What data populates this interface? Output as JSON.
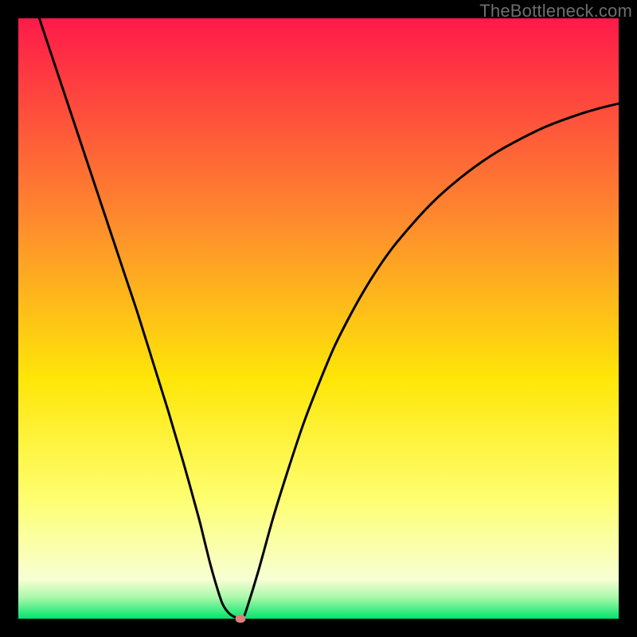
{
  "watermark": "TheBottleneck.com",
  "colors": {
    "top": "#fe1a49",
    "mid_upper": "#fe8f2c",
    "mid": "#fee608",
    "mid_lower": "#feff70",
    "lower_pale": "#f7ffd4",
    "bottom": "#00e46e",
    "curve": "#000000",
    "marker": "#e77b79",
    "frame": "#000000"
  },
  "chart_data": {
    "type": "line",
    "title": "",
    "xlabel": "",
    "ylabel": "",
    "xlim": [
      0,
      100
    ],
    "ylim": [
      0,
      100
    ],
    "x": [
      3.5,
      5,
      7.5,
      10,
      12.5,
      15,
      17.5,
      20,
      22.5,
      25,
      27.5,
      30,
      31,
      32,
      33,
      34,
      35,
      36,
      37,
      37.5,
      38,
      40,
      42.5,
      45,
      47.5,
      50,
      52.5,
      55,
      57.5,
      60,
      62.5,
      65,
      67.5,
      70,
      72.5,
      75,
      77.5,
      80,
      82.5,
      85,
      87.5,
      90,
      92.5,
      95,
      97.5,
      100
    ],
    "values": [
      100,
      95.5,
      88,
      80.5,
      73,
      65.5,
      58,
      50.5,
      42.5,
      34.5,
      26,
      17,
      13,
      9,
      5.5,
      2.5,
      1,
      0.3,
      0,
      0.3,
      1.5,
      8,
      17,
      25,
      32.5,
      39,
      45,
      50,
      54.5,
      58.5,
      62,
      65,
      67.8,
      70.3,
      72.5,
      74.5,
      76.3,
      77.9,
      79.3,
      80.6,
      81.8,
      82.8,
      83.7,
      84.5,
      85.2,
      85.8
    ],
    "marker": {
      "x": 37,
      "y": 0
    },
    "gradient_stops": [
      {
        "offset": 0.0,
        "color": "#fe1a49"
      },
      {
        "offset": 0.35,
        "color": "#fe8f2c"
      },
      {
        "offset": 0.6,
        "color": "#fee608"
      },
      {
        "offset": 0.8,
        "color": "#feff70"
      },
      {
        "offset": 0.935,
        "color": "#f7ffd4"
      },
      {
        "offset": 0.965,
        "color": "#a8f8a8"
      },
      {
        "offset": 1.0,
        "color": "#00e46e"
      }
    ]
  }
}
